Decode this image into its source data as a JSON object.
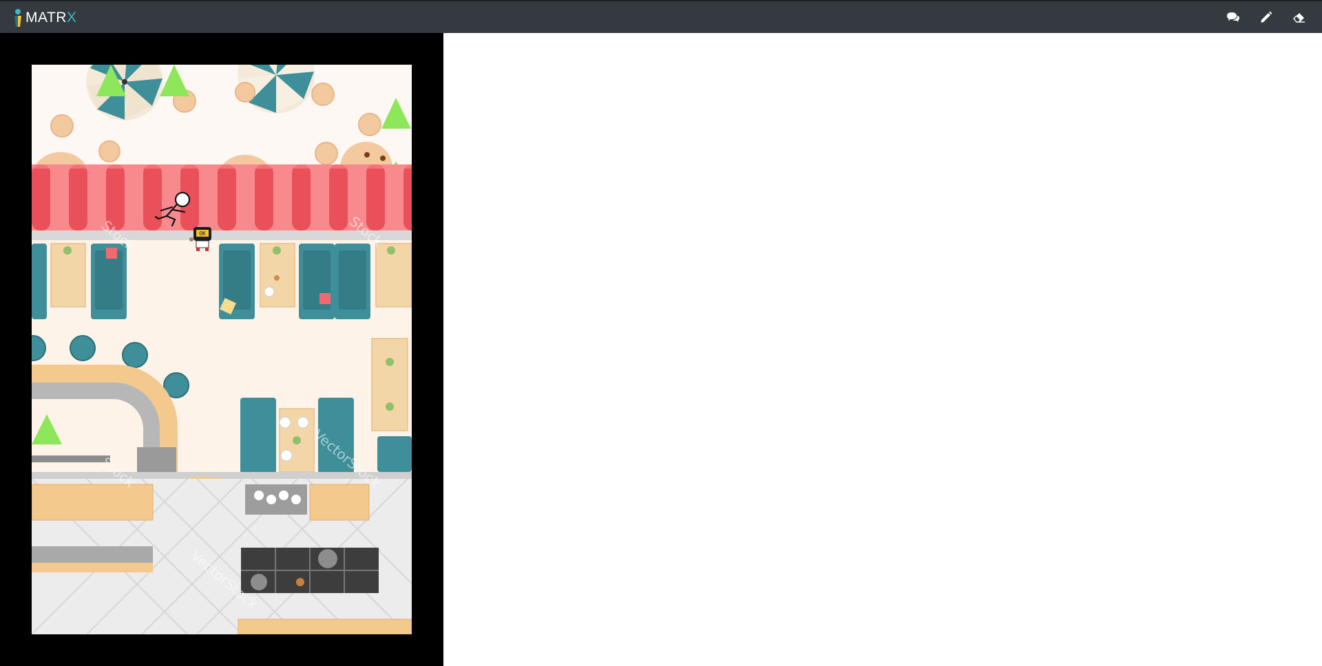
{
  "app": {
    "brand_prefix": "MATR",
    "brand_suffix": "X"
  },
  "nav": {
    "icons": [
      "chat-icon",
      "pencil-icon",
      "eraser-icon"
    ]
  },
  "world": {
    "watermarks": [
      "Stock",
      "Stock",
      "VectorStock",
      "Stock",
      "VectorStock"
    ],
    "agent_badge": "OK"
  },
  "colors": {
    "topbar": "#343a40",
    "accent": "#43b5c9",
    "triangle": "#8ee65a",
    "awning_dark": "#e9505a",
    "awning_light": "#f88a8e",
    "booth": "#3e8f9a",
    "counter": "#f3c98e"
  }
}
